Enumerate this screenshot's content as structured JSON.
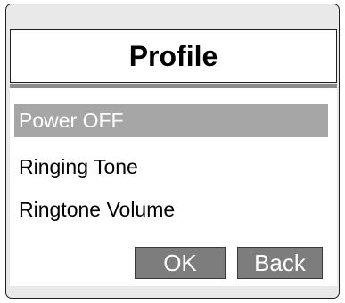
{
  "dialog": {
    "title": "Profile"
  },
  "menu": {
    "items": [
      {
        "label": "Power OFF",
        "selected": true
      },
      {
        "label": "Ringing Tone",
        "selected": false
      },
      {
        "label": "Ringtone Volume",
        "selected": false
      }
    ]
  },
  "buttons": {
    "ok_label": "OK",
    "back_label": "Back"
  },
  "colors": {
    "selection": "#a6a6a6",
    "button": "#7d7d7d",
    "frame": "#e9e9e9"
  }
}
